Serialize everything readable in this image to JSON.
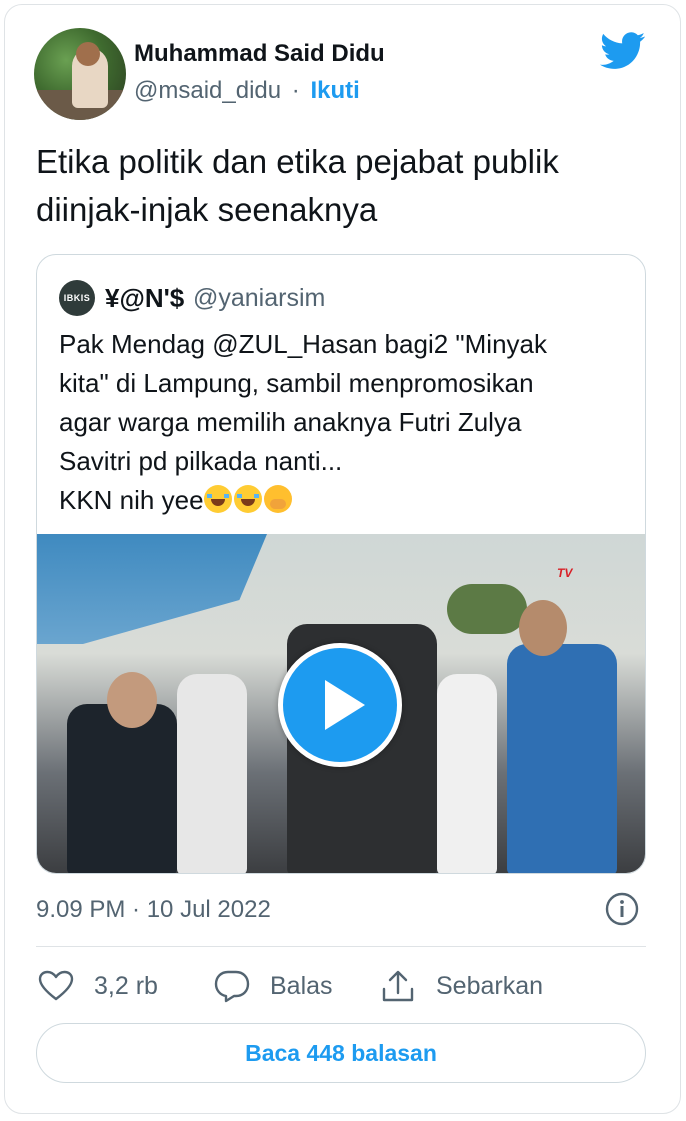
{
  "author": {
    "name": "Muhammad Said Didu",
    "handle": "@msaid_didu",
    "separator": "·",
    "follow_label": "Ikuti"
  },
  "tweet": {
    "text_line_1": "Etika politik dan etika pejabat publik",
    "text_line_2": "diinjak-injak seenaknya",
    "timestamp": "9.09 PM · 10 Jul 2022"
  },
  "quoted": {
    "avatar_text": "IBKIS",
    "name": "¥@N'$",
    "handle": "@yaniarsim",
    "lines": [
      "Pak Mendag @ZUL_Hasan bagi2 \"Minyak",
      "kita\" di Lampung, sambil menpromosikan",
      "agar warga memilih anaknya Futri Zulya",
      "Savitri pd pilkada nanti...",
      "KKN nih yee"
    ],
    "emojis": [
      "face-with-tears-of-joy",
      "face-with-tears-of-joy",
      "face-with-hand-over-mouth"
    ],
    "video_watermark": "TV"
  },
  "actions": {
    "like_count": "3,2 rb",
    "reply_label": "Balas",
    "share_label": "Sebarkan"
  },
  "replies_button": "Baca 448 balasan",
  "colors": {
    "accent": "#1d9bf0",
    "text": "#0f1419",
    "secondary": "#536471",
    "border": "#cfd9de"
  },
  "icons": {
    "brand": "twitter-bird-icon",
    "play": "play-icon",
    "info": "info-icon",
    "like": "heart-icon",
    "reply": "speech-bubble-icon",
    "share": "share-upload-icon"
  }
}
